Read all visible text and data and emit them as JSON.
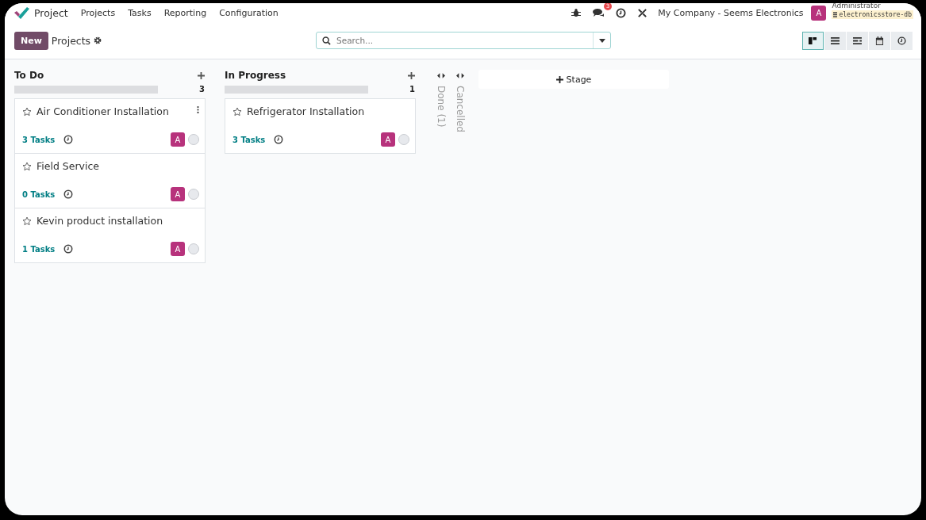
{
  "navbar": {
    "app": "Project",
    "menu": [
      "Projects",
      "Tasks",
      "Reporting",
      "Configuration"
    ],
    "messages_badge": "3",
    "company": "My Company - Seems Electronics",
    "user": {
      "avatar": "A",
      "name": "Administrator",
      "database": "electronicsstore-db"
    }
  },
  "control_panel": {
    "new_button": "New",
    "breadcrumb": "Projects",
    "search": {
      "placeholder": "Search..."
    },
    "views": [
      {
        "kind": "kanban",
        "selected": true
      },
      {
        "kind": "list",
        "selected": false
      },
      {
        "kind": "gantt",
        "selected": false
      },
      {
        "kind": "calendar",
        "selected": false
      },
      {
        "kind": "activity",
        "selected": false
      }
    ]
  },
  "columns": [
    {
      "title": "To Do",
      "count": "3",
      "level": 0,
      "cards": [
        {
          "name": "Air Conditioner Installation",
          "tasks": "3 Tasks",
          "avatar": "A",
          "menu": true
        },
        {
          "name": "Field Service",
          "tasks": "0 Tasks",
          "avatar": "A",
          "menu": false
        },
        {
          "name": "Kevin product installation",
          "tasks": "1 Tasks",
          "avatar": "A",
          "menu": false
        }
      ]
    },
    {
      "title": "In Progress",
      "count": "1",
      "level": 0,
      "cards": [
        {
          "name": "Refrigerator Installation",
          "tasks": "3 Tasks",
          "avatar": "A",
          "menu": false
        }
      ]
    }
  ],
  "folded_columns": [
    "Done (1)",
    "Cancelled"
  ],
  "add_stage": "Stage"
}
